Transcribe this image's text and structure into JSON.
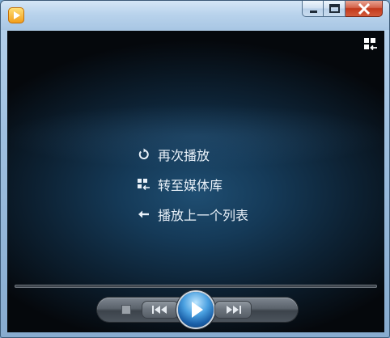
{
  "window": {
    "controls": {
      "minimize_icon": "minimize-icon",
      "maximize_icon": "maximize-icon",
      "close_icon": "close-icon"
    }
  },
  "menu": {
    "items": [
      {
        "label": "再次播放",
        "icon": "replay-icon"
      },
      {
        "label": "转至媒体库",
        "icon": "library-switch-icon"
      },
      {
        "label": "播放上一个列表",
        "icon": "back-arrow-icon"
      }
    ]
  },
  "controls": {
    "stop_icon": "stop-icon",
    "prev_icon": "previous-icon",
    "play_icon": "play-icon",
    "next_icon": "next-icon"
  },
  "colors": {
    "background_dark": "#05080c",
    "background_glow": "#1f4e72",
    "menu_text": "#eaf2fa",
    "play_button": "#1a5fa8",
    "close_button": "#c2391c"
  }
}
